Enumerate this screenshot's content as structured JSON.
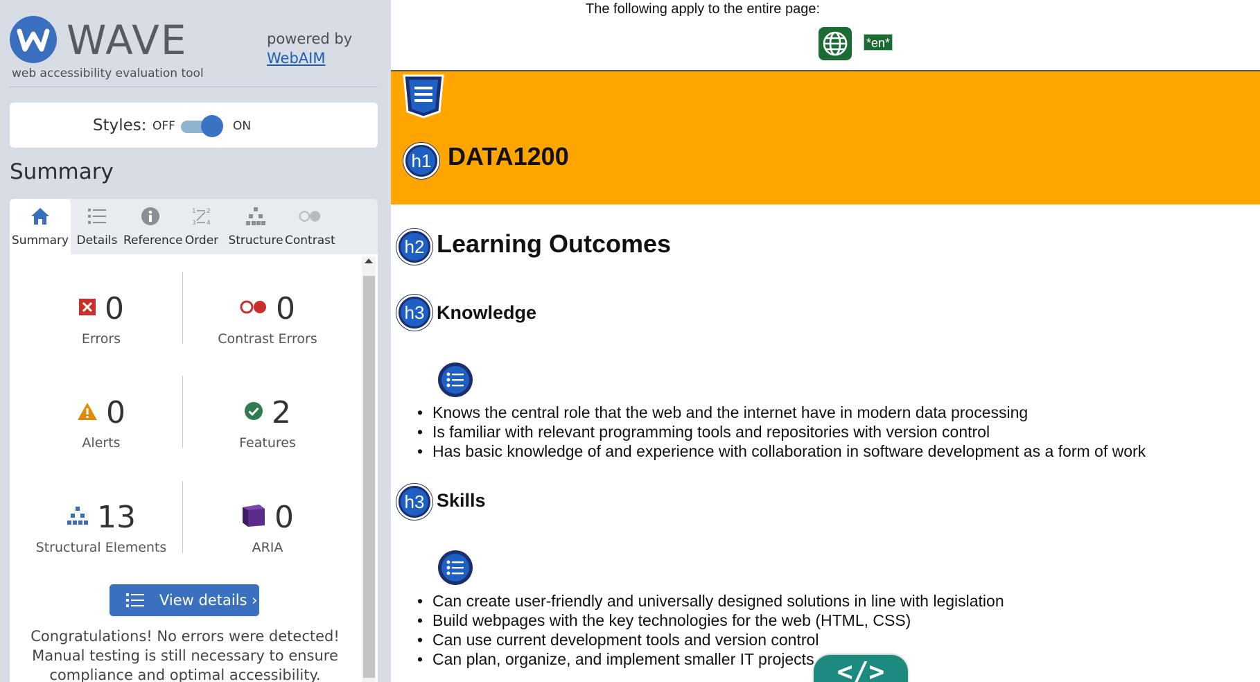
{
  "sidebar": {
    "logo_text": "WAVE",
    "tagline": "web accessibility evaluation tool",
    "powered_by": "powered by",
    "powered_link": "WebAIM",
    "styles": {
      "label": "Styles:",
      "off": "OFF",
      "on": "ON",
      "state": "on"
    },
    "summary_heading": "Summary",
    "tabs": [
      {
        "label": "Summary",
        "icon": "home-icon",
        "active": true
      },
      {
        "label": "Details",
        "icon": "list-icon"
      },
      {
        "label": "Reference",
        "icon": "info-icon"
      },
      {
        "label": "Order",
        "icon": "order-icon"
      },
      {
        "label": "Structure",
        "icon": "structure-icon"
      },
      {
        "label": "Contrast",
        "icon": "contrast-icon"
      }
    ],
    "stats": {
      "errors": {
        "value": "0",
        "label": "Errors"
      },
      "contrast_errors": {
        "value": "0",
        "label": "Contrast Errors"
      },
      "alerts": {
        "value": "0",
        "label": "Alerts"
      },
      "features": {
        "value": "2",
        "label": "Features"
      },
      "structural": {
        "value": "13",
        "label": "Structural Elements"
      },
      "aria": {
        "value": "0",
        "label": "ARIA"
      }
    },
    "view_details": "View details ›",
    "congrats_lines": [
      "Congratulations! No errors were detected!",
      "Manual testing is still necessary to ensure",
      "compliance and optimal accessibility."
    ]
  },
  "page": {
    "apply_text": "The following apply to the entire page:",
    "lang_badge": "*en*",
    "h1_badge": "h1",
    "h1": "DATA1200",
    "h2_badge": "h2",
    "h2": "Learning Outcomes",
    "h3_badge": "h3",
    "knowledge": {
      "heading": "Knowledge",
      "items": [
        "Knows the central role that the web and the internet have in modern data processing",
        "Is familiar with relevant programming tools and repositories with version control",
        "Has basic knowledge of and experience with collaboration in software development as a form of work"
      ]
    },
    "skills": {
      "heading": "Skills",
      "items": [
        "Can create user-friendly and universally designed solutions in line with legislation",
        "Build webpages with the key technologies for the web (HTML, CSS)",
        "Can use current development tools and version control",
        "Can plan, organize, and implement smaller IT projects"
      ]
    },
    "code_toggle": "</>"
  },
  "colors": {
    "sidebar_bg": "#d8dde5",
    "accent_blue": "#3a70bf",
    "banner_orange": "#ffa500",
    "badge_navy": "#1b2f70",
    "lang_green": "#1c6b34",
    "code_teal": "#1c8a7f"
  }
}
